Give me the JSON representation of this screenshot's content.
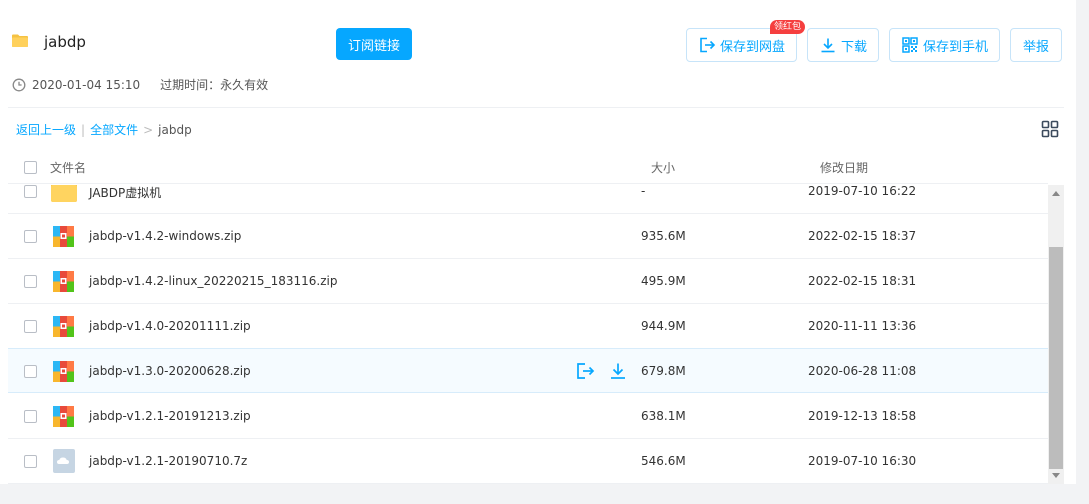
{
  "share": {
    "title": "jabdp",
    "subscribe_label": "订阅链接",
    "created": "2020-01-04 15:10",
    "expire_text": "过期时间：永久有效"
  },
  "toolbar": {
    "save_cloud_label": "保存到网盘",
    "badge_label": "领红包",
    "download_label": "下载",
    "save_phone_label": "保存到手机",
    "report_label": "举报"
  },
  "breadcrumb": {
    "back_label": "返回上一级",
    "sep1": "|",
    "all_label": "全部文件",
    "sep2": ">",
    "current": "jabdp"
  },
  "table": {
    "col_name": "文件名",
    "col_size": "大小",
    "col_date": "修改日期"
  },
  "files": [
    {
      "name": "JABDP虚拟机",
      "size": "-",
      "date": "2019-07-10 16:22",
      "type": "folder-icon"
    },
    {
      "name": "jabdp-v1.4.2-windows.zip",
      "size": "935.6M",
      "date": "2022-02-15 18:37",
      "type": "zip-icon"
    },
    {
      "name": "jabdp-v1.4.2-linux_20220215_183116.zip",
      "size": "495.9M",
      "date": "2022-02-15 18:31",
      "type": "zip-icon"
    },
    {
      "name": "jabdp-v1.4.0-20201111.zip",
      "size": "944.9M",
      "date": "2020-11-11 13:36",
      "type": "zip-icon"
    },
    {
      "name": "jabdp-v1.3.0-20200628.zip",
      "size": "679.8M",
      "date": "2020-06-28 11:08",
      "type": "zip-icon"
    },
    {
      "name": "jabdp-v1.2.1-20191213.zip",
      "size": "638.1M",
      "date": "2019-12-13 18:58",
      "type": "zip-icon"
    },
    {
      "name": "jabdp-v1.2.1-20190710.7z",
      "size": "546.6M",
      "date": "2019-07-10 16:30",
      "type": "archive-icon"
    }
  ],
  "colors": {
    "accent": "#06a7ff",
    "badge": "#f53f3f",
    "hover_row": "#f5fbff"
  }
}
